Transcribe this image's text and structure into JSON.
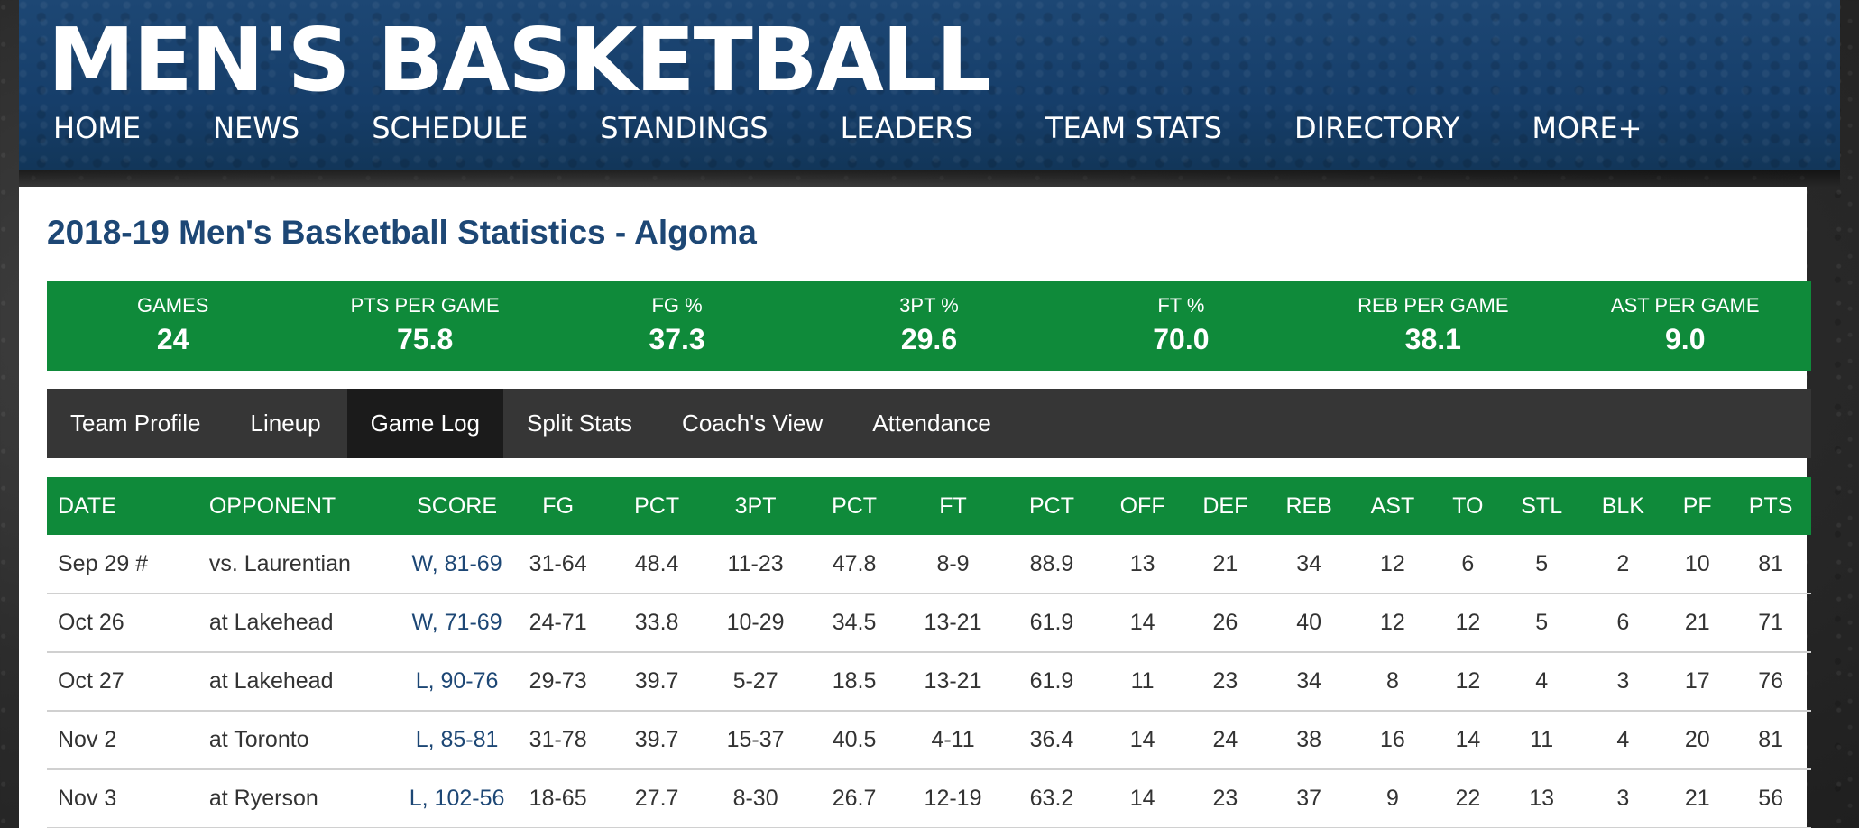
{
  "site": {
    "title": "MEN'S BASKETBALL",
    "nav": [
      "HOME",
      "NEWS",
      "SCHEDULE",
      "STANDINGS",
      "LEADERS",
      "TEAM STATS",
      "DIRECTORY",
      "MORE+"
    ]
  },
  "page_title": "2018-19 Men's Basketball Statistics - Algoma",
  "summary": [
    {
      "label": "GAMES",
      "value": "24"
    },
    {
      "label": "PTS PER GAME",
      "value": "75.8"
    },
    {
      "label": "FG %",
      "value": "37.3"
    },
    {
      "label": "3PT %",
      "value": "29.6"
    },
    {
      "label": "FT %",
      "value": "70.0"
    },
    {
      "label": "REB PER GAME",
      "value": "38.1"
    },
    {
      "label": "AST PER GAME",
      "value": "9.0"
    }
  ],
  "subtabs": {
    "items": [
      "Team Profile",
      "Lineup",
      "Game Log",
      "Split Stats",
      "Coach's View",
      "Attendance"
    ],
    "active": "Game Log"
  },
  "table": {
    "columns": [
      "DATE",
      "OPPONENT",
      "SCORE",
      "FG",
      "PCT",
      "3PT",
      "PCT",
      "FT",
      "PCT",
      "OFF",
      "DEF",
      "REB",
      "AST",
      "TO",
      "STL",
      "BLK",
      "PF",
      "PTS"
    ],
    "rows": [
      [
        "Sep 29 #",
        "vs. Laurentian",
        "W, 81-69",
        "31-64",
        "48.4",
        "11-23",
        "47.8",
        "8-9",
        "88.9",
        "13",
        "21",
        "34",
        "12",
        "6",
        "5",
        "2",
        "10",
        "81"
      ],
      [
        "Oct 26",
        "at Lakehead",
        "W, 71-69",
        "24-71",
        "33.8",
        "10-29",
        "34.5",
        "13-21",
        "61.9",
        "14",
        "26",
        "40",
        "12",
        "12",
        "5",
        "6",
        "21",
        "71"
      ],
      [
        "Oct 27",
        "at Lakehead",
        "L, 90-76",
        "29-73",
        "39.7",
        "5-27",
        "18.5",
        "13-21",
        "61.9",
        "11",
        "23",
        "34",
        "8",
        "12",
        "4",
        "3",
        "17",
        "76"
      ],
      [
        "Nov 2",
        "at Toronto",
        "L, 85-81",
        "31-78",
        "39.7",
        "15-37",
        "40.5",
        "4-11",
        "36.4",
        "14",
        "24",
        "38",
        "16",
        "14",
        "11",
        "4",
        "20",
        "81"
      ],
      [
        "Nov 3",
        "at Ryerson",
        "L, 102-56",
        "18-65",
        "27.7",
        "8-30",
        "26.7",
        "12-19",
        "63.2",
        "14",
        "23",
        "37",
        "9",
        "22",
        "13",
        "3",
        "21",
        "56"
      ]
    ]
  },
  "colors": {
    "header_blue": "#1d4774",
    "stat_green": "#0f8a3a",
    "tab_dark": "#363636",
    "tab_active": "#1b1b1b",
    "title_blue": "#1d4775"
  }
}
